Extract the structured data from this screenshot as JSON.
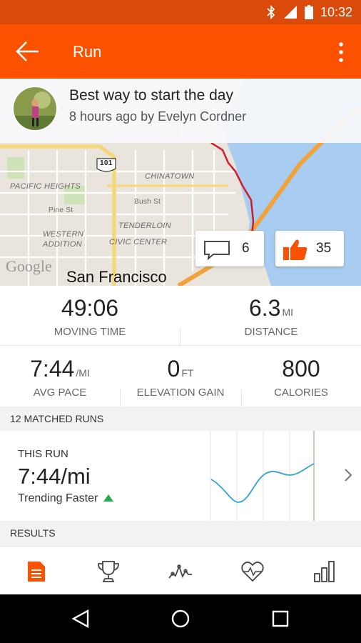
{
  "status_bar": {
    "time": "10:32"
  },
  "app_bar": {
    "title": "Run"
  },
  "activity": {
    "title": "Best way to start the day",
    "meta": "8 hours ago by Evelyn Cordner",
    "city": "San Francisco",
    "map_labels": [
      "PACIFIC HEIGHTS",
      "CHINATOWN",
      "TENDERLOIN",
      "WESTERN",
      "ADDITION",
      "CIVIC CENTER",
      "Pine St",
      "Bush St",
      "101"
    ],
    "map_watermark": "Google",
    "comments": "6",
    "kudos": "35"
  },
  "stats": {
    "moving_time": {
      "value": "49:06",
      "label": "MOVING TIME"
    },
    "distance": {
      "value": "6.3",
      "unit": "MI",
      "label": "DISTANCE"
    },
    "avg_pace": {
      "value": "7:44",
      "unit": "/MI",
      "label": "AVG PACE"
    },
    "elevation": {
      "value": "0",
      "unit": "FT",
      "label": "ELEVATION GAIN"
    },
    "calories": {
      "value": "800",
      "label": "CALORIES"
    }
  },
  "matched_runs": {
    "header": "12 MATCHED RUNS",
    "caption": "THIS RUN",
    "pace": "7:44/mi",
    "trend": "Trending Faster"
  },
  "results": {
    "header": "RESULTS"
  },
  "bottom_nav": [
    "overview-icon",
    "trophy-icon",
    "pace-chart-icon",
    "heart-rate-icon",
    "analysis-icon"
  ],
  "colors": {
    "brand": "#fc5200",
    "status_bar": "#d94a0b",
    "trend_up": "#2aa651",
    "chart_line": "#2fa3d6"
  }
}
